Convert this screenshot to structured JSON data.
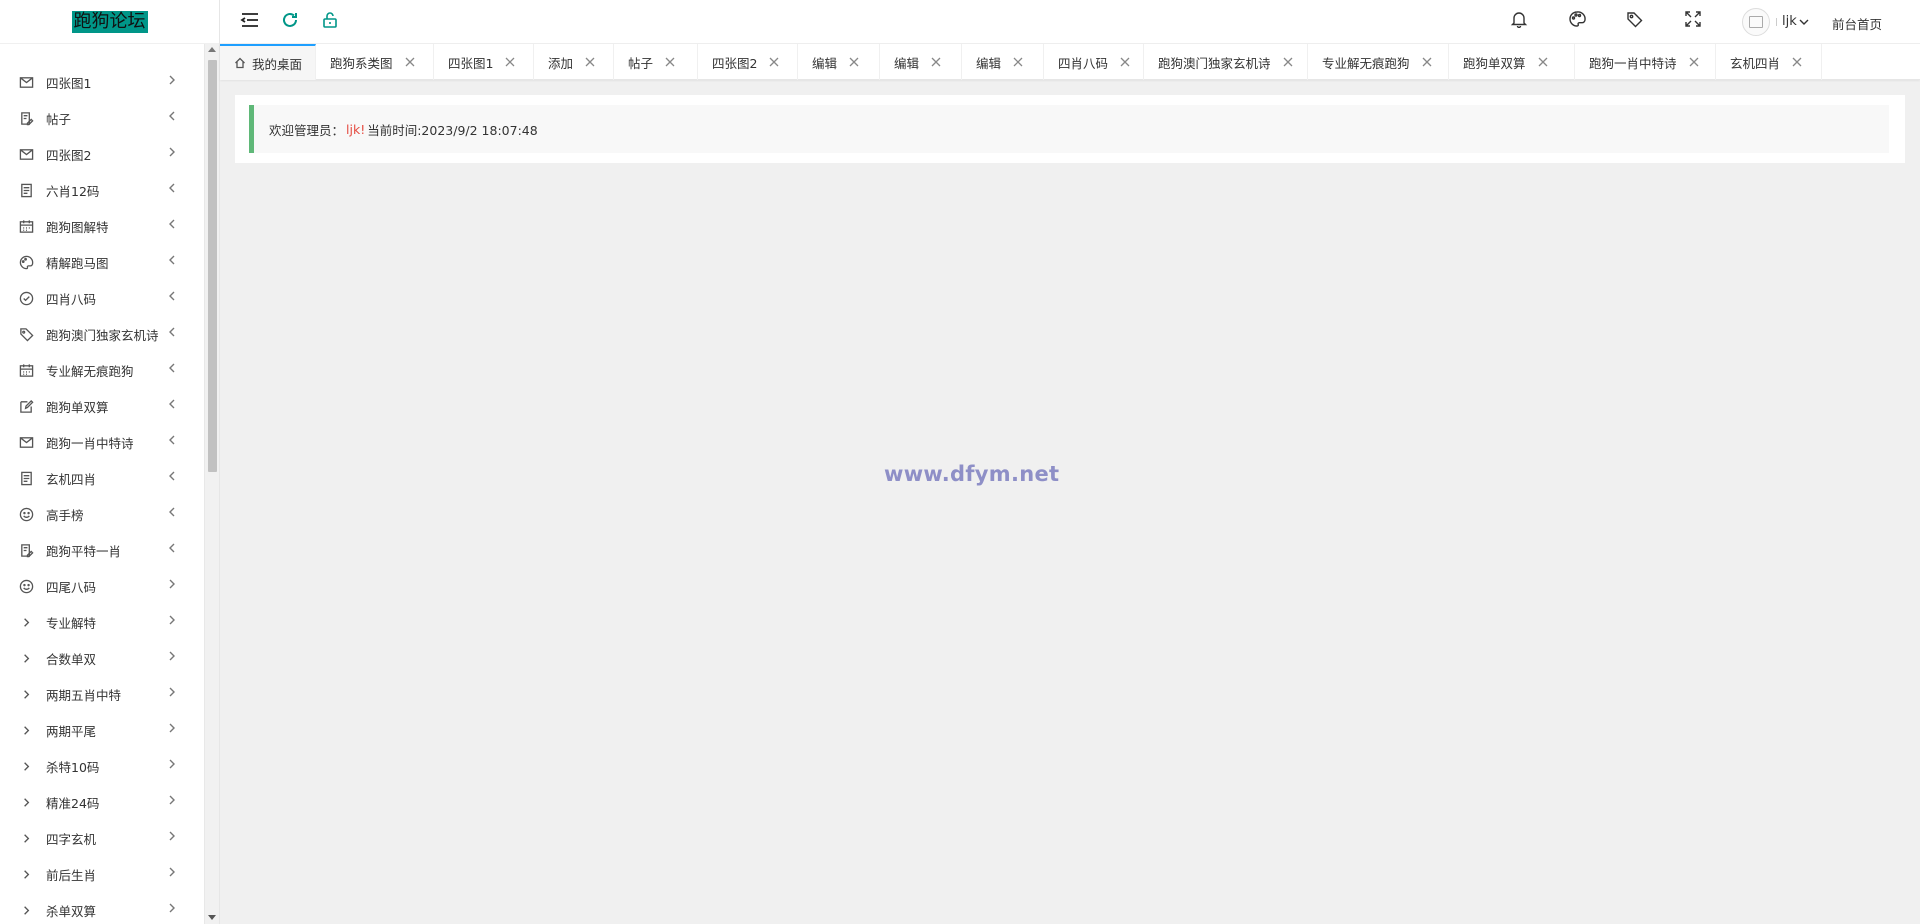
{
  "logo": {
    "text": "跑狗论坛",
    "bg_color": "#009688"
  },
  "sidebar": {
    "items": [
      {
        "label": "四张图1",
        "icon": "mail-icon",
        "arrow": "right"
      },
      {
        "label": "帖子",
        "icon": "edit-doc-icon",
        "arrow": "left"
      },
      {
        "label": "四张图2",
        "icon": "mail-icon",
        "arrow": "right"
      },
      {
        "label": "六肖12码",
        "icon": "notebook-icon",
        "arrow": "left"
      },
      {
        "label": "跑狗图解特",
        "icon": "calendar-icon",
        "arrow": "left"
      },
      {
        "label": "精解跑马图",
        "icon": "palette-icon",
        "arrow": "left"
      },
      {
        "label": "四肖八码",
        "icon": "check-circle-icon",
        "arrow": "left"
      },
      {
        "label": "跑狗澳门独家玄机诗",
        "icon": "tag-icon",
        "arrow": "left"
      },
      {
        "label": "专业解无痕跑狗",
        "icon": "calendar-icon",
        "arrow": "left"
      },
      {
        "label": "跑狗单双算",
        "icon": "edit-icon",
        "arrow": "left"
      },
      {
        "label": "跑狗一肖中特诗",
        "icon": "mail-icon",
        "arrow": "left"
      },
      {
        "label": "玄机四肖",
        "icon": "notebook-icon",
        "arrow": "left"
      },
      {
        "label": "高手榜",
        "icon": "smile-icon",
        "arrow": "left"
      },
      {
        "label": "跑狗平特一肖",
        "icon": "edit-doc-icon",
        "arrow": "left"
      },
      {
        "label": "四尾八码",
        "icon": "smile-icon",
        "arrow": "right"
      },
      {
        "label": "专业解特",
        "icon": "chevron-right-icon",
        "arrow": "right"
      },
      {
        "label": "合数单双",
        "icon": "chevron-right-icon",
        "arrow": "right"
      },
      {
        "label": "两期五肖中特",
        "icon": "chevron-right-icon",
        "arrow": "right"
      },
      {
        "label": "两期平尾",
        "icon": "chevron-right-icon",
        "arrow": "right"
      },
      {
        "label": "杀特10码",
        "icon": "chevron-right-icon",
        "arrow": "right"
      },
      {
        "label": "精准24码",
        "icon": "chevron-right-icon",
        "arrow": "right"
      },
      {
        "label": "四字玄机",
        "icon": "chevron-right-icon",
        "arrow": "right"
      },
      {
        "label": "前后生肖",
        "icon": "chevron-right-icon",
        "arrow": "right"
      },
      {
        "label": "杀单双算",
        "icon": "chevron-right-icon",
        "arrow": "right"
      }
    ]
  },
  "header": {
    "icons": [
      "menu-fold-icon",
      "refresh-icon",
      "lock-icon",
      "bell-icon",
      "palette-icon",
      "tag-icon",
      "fullscreen-icon"
    ],
    "refresh_color": "#009688",
    "lock_color": "#009688",
    "username": "ljk",
    "front_link": "前台首页"
  },
  "tabs": [
    {
      "label": "我的桌面",
      "active": true
    },
    {
      "label": "跑狗系类图"
    },
    {
      "label": "四张图1"
    },
    {
      "label": "添加"
    },
    {
      "label": "帖子"
    },
    {
      "label": "四张图2"
    },
    {
      "label": "编辑"
    },
    {
      "label": "编辑"
    },
    {
      "label": "编辑"
    },
    {
      "label": "四肖八码"
    },
    {
      "label": "跑狗澳门独家玄机诗"
    },
    {
      "label": "专业解无痕跑狗"
    },
    {
      "label": "跑狗单双算"
    },
    {
      "label": "跑狗一肖中特诗"
    },
    {
      "label": "玄机四肖"
    }
  ],
  "welcome": {
    "prefix": "欢迎管理员：",
    "user": "ljk!",
    "time_label": "当前时间:2023/9/2 18:07:48",
    "accent_color": "#5fb878"
  },
  "watermark": "www.dfym.net"
}
